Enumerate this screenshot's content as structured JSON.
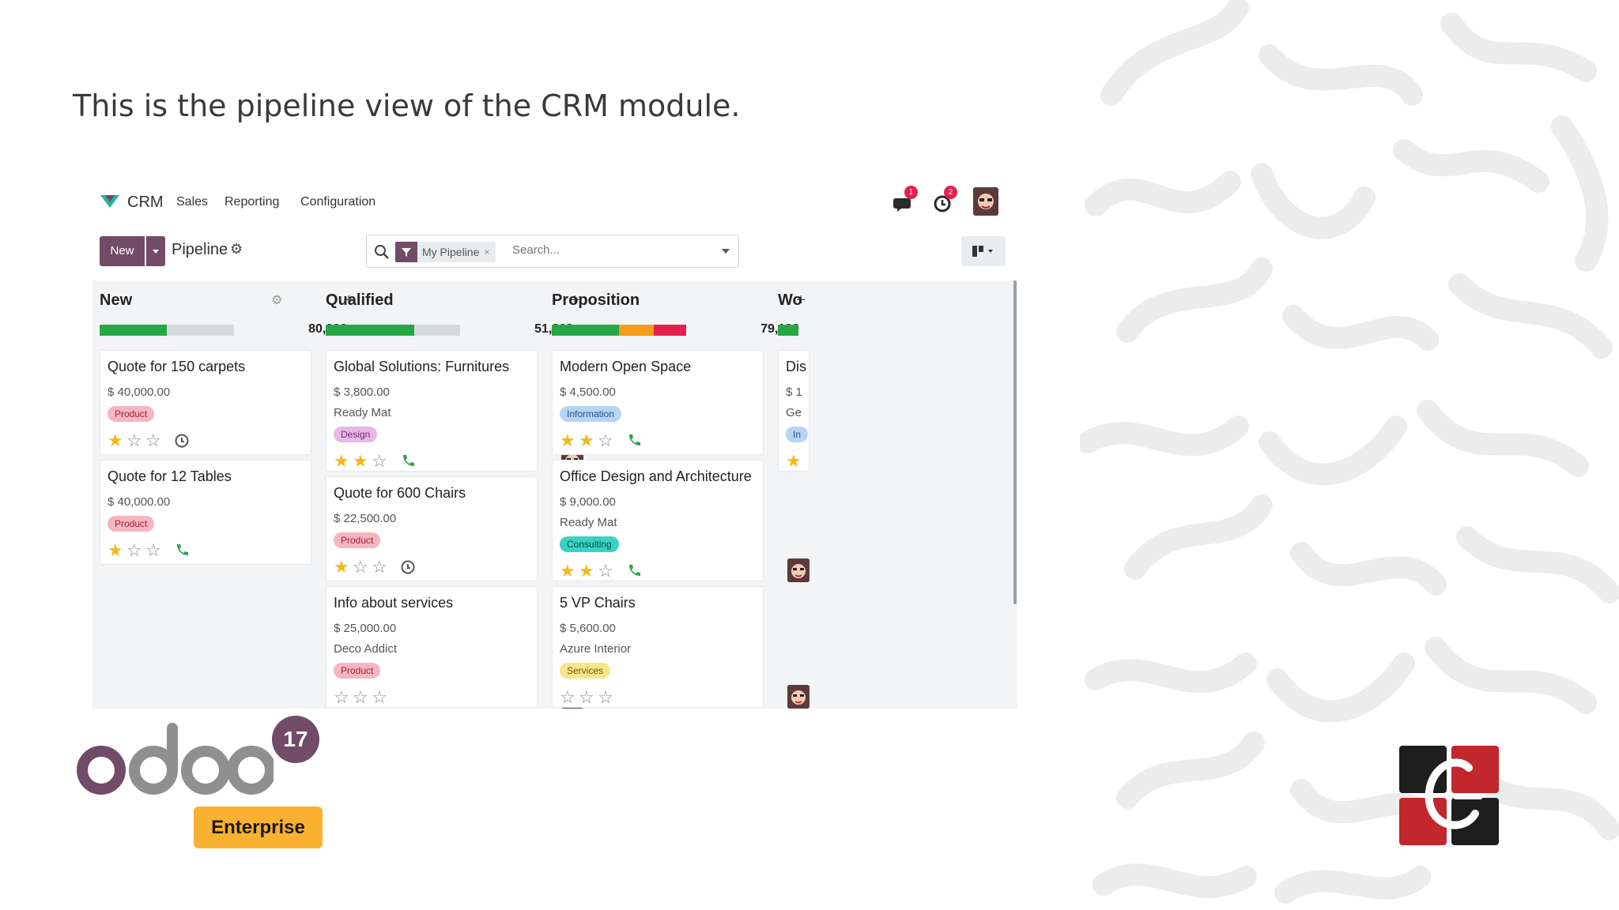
{
  "caption": "This is the pipeline view of the CRM module.",
  "topbar": {
    "app_name": "CRM",
    "menu": [
      "Sales",
      "Reporting",
      "Configuration"
    ],
    "messages_badge": "1",
    "activities_badge": "2"
  },
  "control": {
    "new_label": "New",
    "breadcrumb": "Pipeline",
    "gear_glyph": "⚙",
    "facet_label": "My Pipeline",
    "facet_remove": "×",
    "search_placeholder": "Search..."
  },
  "columns": [
    {
      "name": "New",
      "total": "80,000",
      "progress": [
        {
          "color": "#28a745",
          "fraction": 0.5
        }
      ],
      "cards": [
        {
          "title": "Quote for 150 carpets",
          "amount": "$ 40,000.00",
          "partner": "",
          "tag": "Product",
          "tag_bg": "#f5b6c0",
          "tag_fg": "#a3203b",
          "stars": 1,
          "activity": "clock-icon"
        },
        {
          "title": "Quote for 12 Tables",
          "amount": "$ 40,000.00",
          "partner": "",
          "tag": "Product",
          "tag_bg": "#f5b6c0",
          "tag_fg": "#a3203b",
          "stars": 1,
          "activity": "phone-icon"
        }
      ]
    },
    {
      "name": "Qualified",
      "total": "51,300",
      "progress": [
        {
          "color": "#28a745",
          "fraction": 0.66
        }
      ],
      "cards": [
        {
          "title": "Global Solutions: Furnitures",
          "amount": "$ 3,800.00",
          "partner": "Ready Mat",
          "tag": "Design",
          "tag_bg": "#e6b8e6",
          "tag_fg": "#7b2a7b",
          "stars": 2,
          "activity": "phone-icon"
        },
        {
          "title": "Quote for 600 Chairs",
          "amount": "$ 22,500.00",
          "partner": "",
          "tag": "Product",
          "tag_bg": "#f5b6c0",
          "tag_fg": "#a3203b",
          "stars": 1,
          "activity": "clock-icon"
        },
        {
          "title": "Info about services",
          "amount": "$ 25,000.00",
          "partner": "Deco Addict",
          "tag": "Product",
          "tag_bg": "#f5b6c0",
          "tag_fg": "#a3203b",
          "stars": 0,
          "activity": ""
        }
      ]
    },
    {
      "name": "Proposition",
      "total": "79,100",
      "progress": [
        {
          "color": "#28a745",
          "fraction": 0.5
        },
        {
          "color": "#f59c1a",
          "fraction": 0.26
        },
        {
          "color": "#e3204d",
          "fraction": 0.24
        }
      ],
      "cards": [
        {
          "title": "Modern Open Space",
          "amount": "$ 4,500.00",
          "partner": "",
          "tag": "Information",
          "tag_bg": "#b6d4f5",
          "tag_fg": "#22528a",
          "stars": 2,
          "activity": "phone-icon"
        },
        {
          "title": "Office Design and Architecture",
          "amount": "$ 9,000.00",
          "partner": "Ready Mat",
          "tag": "Consulting",
          "tag_bg": "#3ad1c3",
          "tag_fg": "#0a4f48",
          "stars": 2,
          "activity": "phone-icon"
        },
        {
          "title": "5 VP Chairs",
          "amount": "$ 5,600.00",
          "partner": "Azure Interior",
          "tag": "Services",
          "tag_bg": "#f8e58a",
          "tag_fg": "#6e5b00",
          "stars": 0,
          "activity": ""
        }
      ]
    },
    {
      "name": "Wo",
      "total": "",
      "progress": [
        {
          "color": "#28a745",
          "fraction": 1
        }
      ],
      "cards": [
        {
          "title": "Dis",
          "amount": "$ 1",
          "partner": "Ge",
          "tag": "In",
          "tag_bg": "#b6d4f5",
          "tag_fg": "#22528a",
          "stars": 1,
          "activity": ""
        }
      ]
    }
  ],
  "brand": {
    "odoo_version": "17",
    "edition": "Enterprise",
    "primary": "#714b67",
    "accent": "#fbb130"
  }
}
